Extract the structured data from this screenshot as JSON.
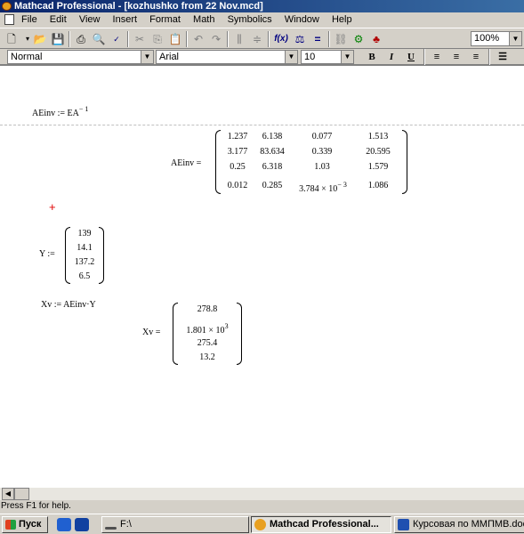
{
  "window": {
    "title": "Mathcad Professional - [kozhushko from 22 Nov.mcd]"
  },
  "menu": [
    "File",
    "Edit",
    "View",
    "Insert",
    "Format",
    "Math",
    "Symbolics",
    "Window",
    "Help"
  ],
  "toolbar": {
    "zoom": "100%"
  },
  "format": {
    "style": "Normal",
    "font": "Arial",
    "size": "10",
    "bold": "B",
    "italic": "I",
    "underline": "U"
  },
  "worksheet": {
    "def1": {
      "lhs": "AEinv",
      "op": ":=",
      "rhs": "EA",
      "exp": "− 1"
    },
    "result1": {
      "lhs": "AEinv =",
      "rows": [
        [
          "1.237",
          "6.138",
          "0.077",
          "1.513"
        ],
        [
          "3.177",
          "83.634",
          "0.339",
          "20.595"
        ],
        [
          "0.25",
          "6.318",
          "1.03",
          "1.579"
        ],
        [
          "0.012",
          "0.285",
          "3.784 × 10",
          "1.086"
        ]
      ],
      "sci_exp": "− 3"
    },
    "cursor": "+",
    "def2": {
      "lhs": "Y :=",
      "values": [
        "139",
        "14.1",
        "137.2",
        "6.5"
      ]
    },
    "def3": {
      "text": "Xv := AEinv·Y"
    },
    "result2": {
      "lhs": "Xv =",
      "values": [
        "278.8",
        "1.801 × 10",
        "275.4",
        "13.2"
      ],
      "sci_exp": "3"
    }
  },
  "statusbar": {
    "text": "Press F1 for help."
  },
  "taskbar": {
    "start": "Пуск",
    "items": [
      "F:\\",
      "Mathcad Professional...",
      "Курсовая по ММПМВ.doc"
    ]
  }
}
